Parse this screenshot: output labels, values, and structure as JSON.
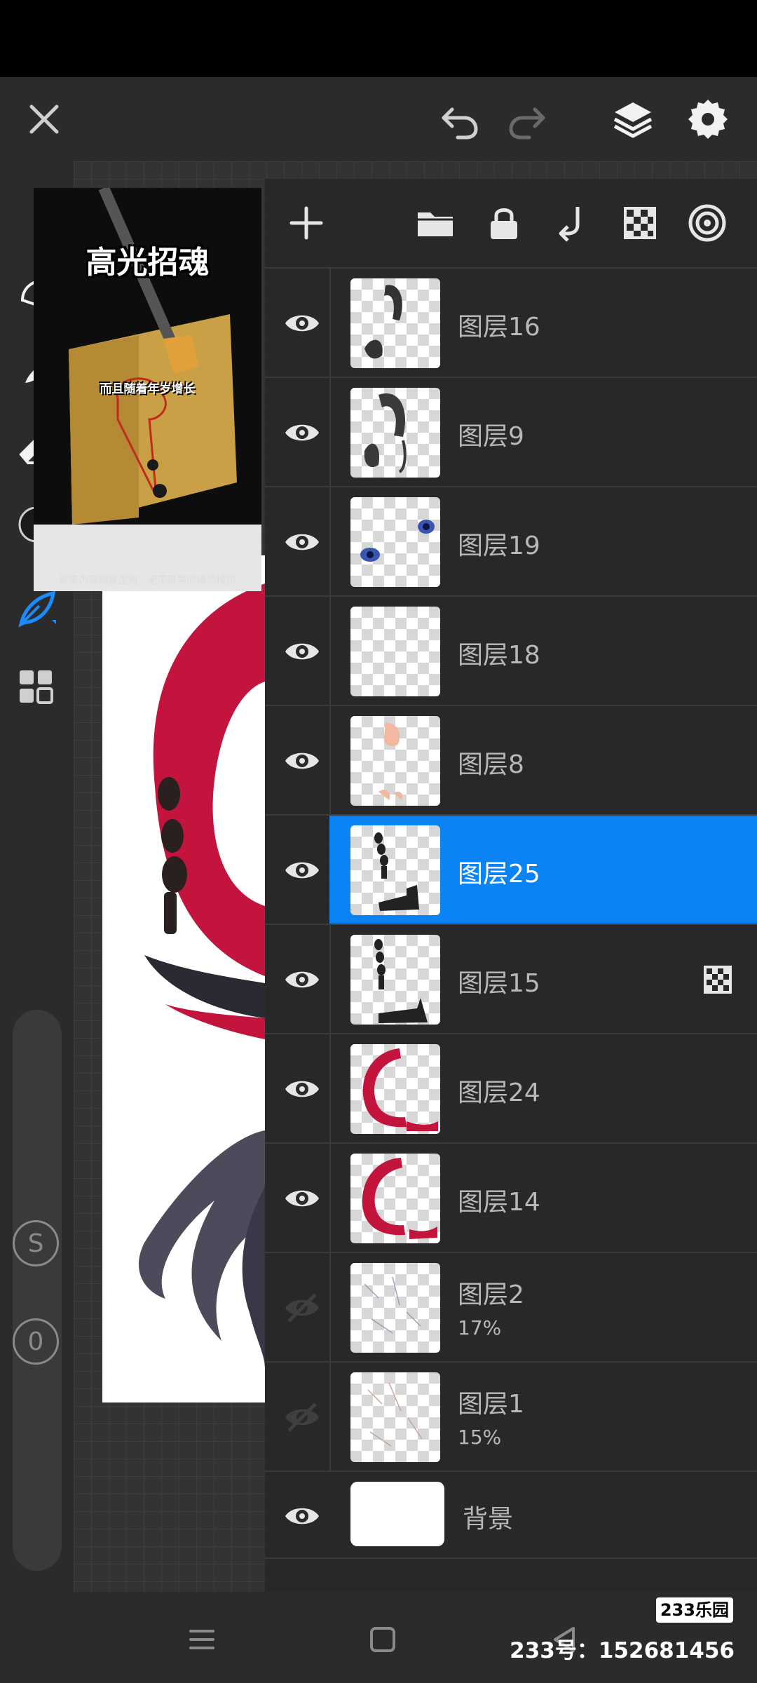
{
  "video_overlay": {
    "title": "高光招魂",
    "caption": "而且随着年岁增长",
    "disclaimer": "故事内容纯属虚构，无不良导向请勿模仿"
  },
  "layers": [
    {
      "name": "图层16",
      "visible": true,
      "selected": false,
      "icon": "layer-thumb-hair-figure"
    },
    {
      "name": "图层9",
      "visible": true,
      "selected": false,
      "icon": "layer-thumb-hair-figure"
    },
    {
      "name": "图层19",
      "visible": true,
      "selected": false,
      "icon": "layer-thumb-blue-eyes"
    },
    {
      "name": "图层18",
      "visible": true,
      "selected": false,
      "icon": "layer-thumb-empty"
    },
    {
      "name": "图层8",
      "visible": true,
      "selected": false,
      "icon": "layer-thumb-skin"
    },
    {
      "name": "图层25",
      "visible": true,
      "selected": true,
      "icon": "layer-thumb-text-mark"
    },
    {
      "name": "图层15",
      "visible": true,
      "selected": false,
      "icon": "layer-thumb-text-mark",
      "alpha_lock": true
    },
    {
      "name": "图层24",
      "visible": true,
      "selected": false,
      "icon": "layer-thumb-red-ring"
    },
    {
      "name": "图层14",
      "visible": true,
      "selected": false,
      "icon": "layer-thumb-red-ring"
    },
    {
      "name": "图层2",
      "visible": false,
      "selected": false,
      "opacity": "17%",
      "icon": "layer-thumb-sketch"
    },
    {
      "name": "图层1",
      "visible": false,
      "selected": false,
      "opacity": "15%",
      "icon": "layer-thumb-sketch"
    }
  ],
  "background_layer": {
    "name": "背景",
    "visible": true
  },
  "colors": {
    "selection": "#0a84f5",
    "accent_tool": "#1a8cff",
    "ring_red": "#c2143d"
  },
  "watermark": {
    "logo": "233乐园",
    "id_text": "233号：152681456"
  }
}
